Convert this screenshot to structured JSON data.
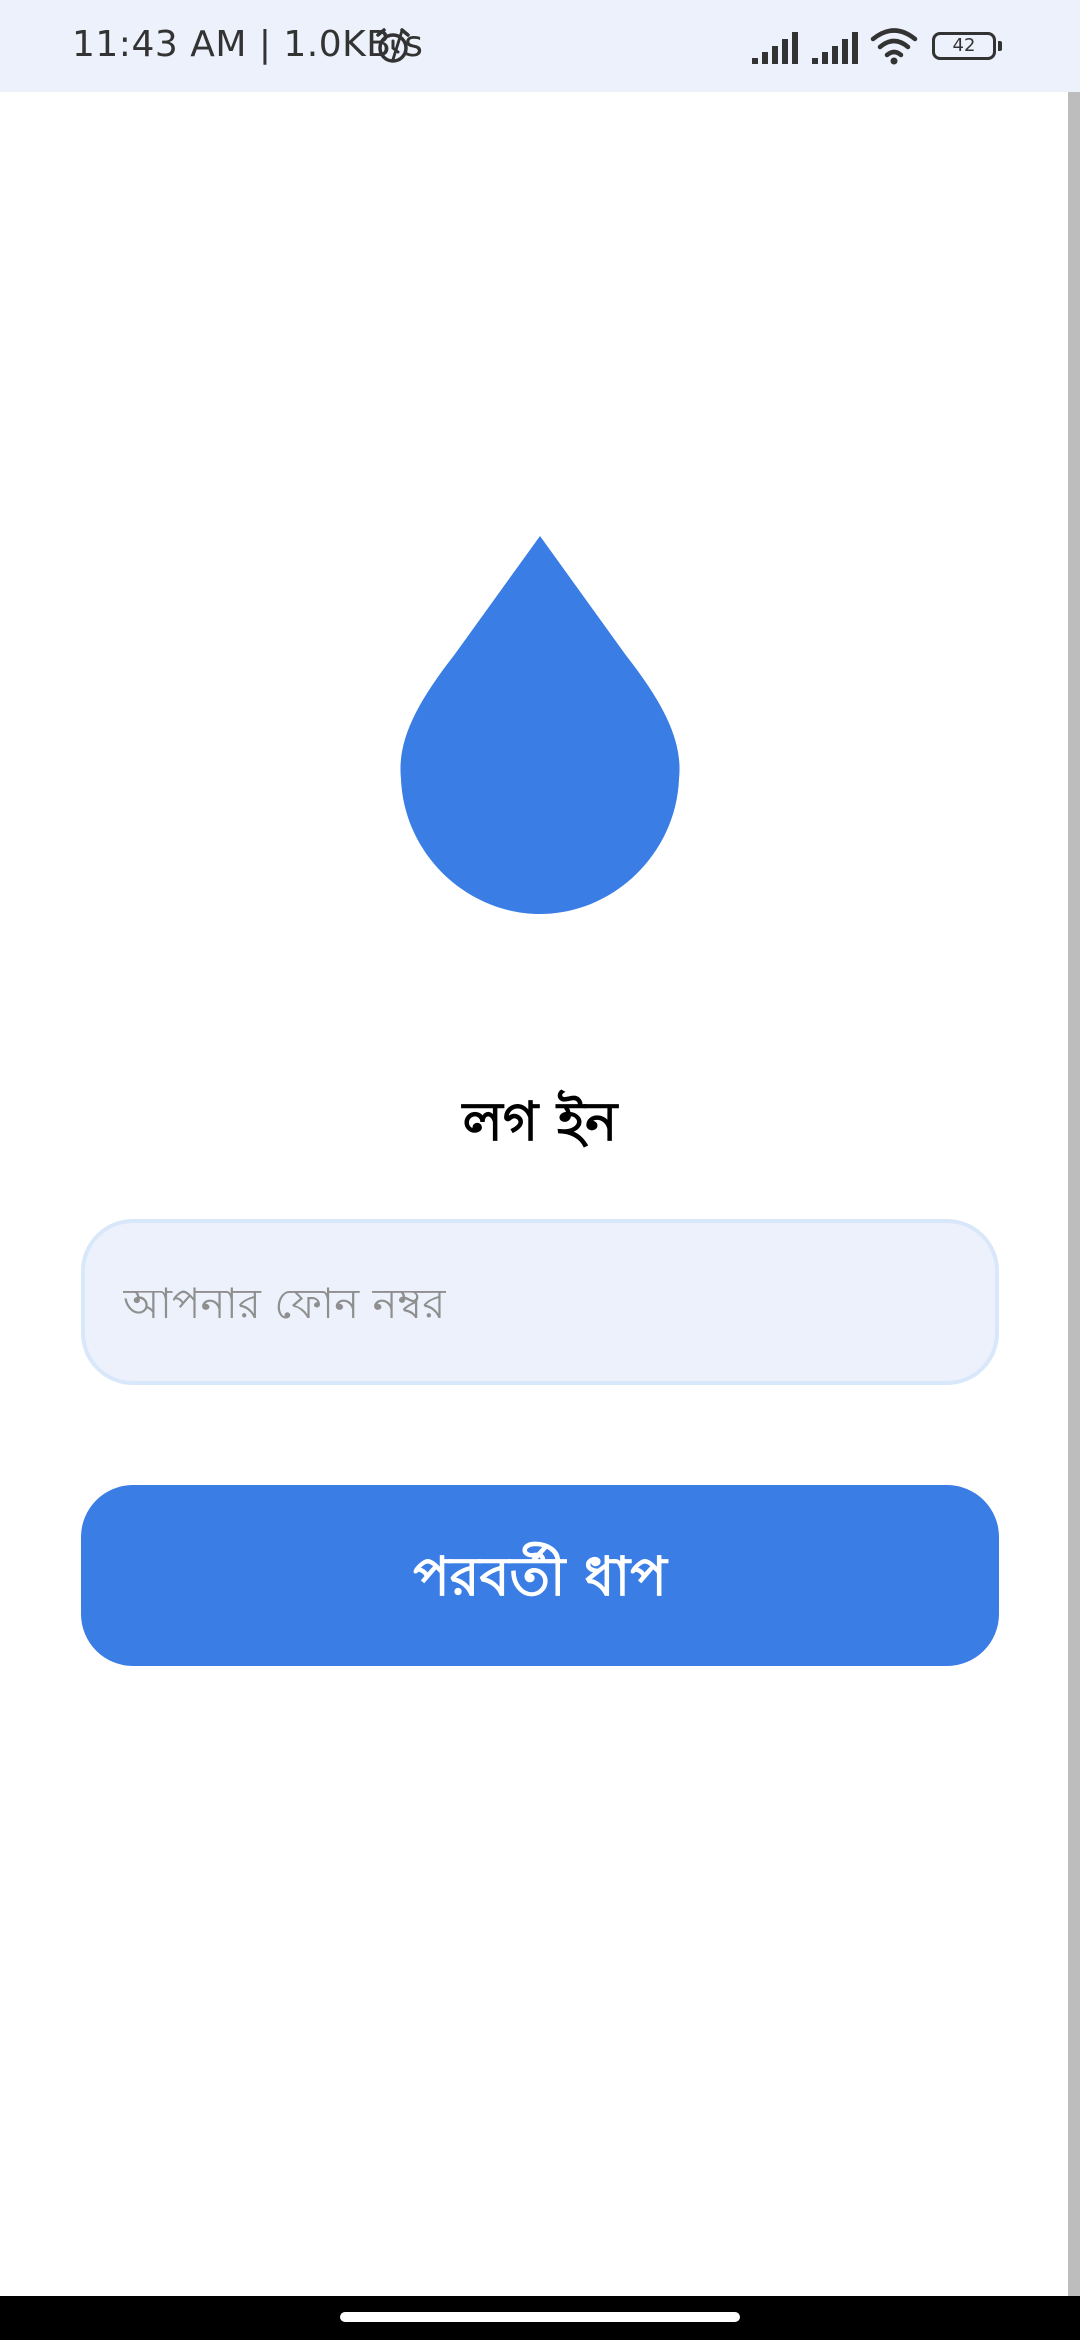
{
  "status_bar": {
    "time_speed": "11:43 AM | 1.0KB/s",
    "battery_level": "42",
    "icons": [
      "alarm-icon",
      "signal-icon",
      "signal-icon",
      "wifi-icon",
      "battery-icon"
    ]
  },
  "logo": {
    "icon": "water-drop-icon",
    "color": "#3a7de5"
  },
  "login": {
    "title": "লগ ইন",
    "phone_placeholder": "আপনার ফোন নম্বর",
    "phone_value": "",
    "next_label": "পরবর্তী ধাপ"
  },
  "colors": {
    "accent": "#3a7de5",
    "input_bg": "#ecf1fb",
    "status_bar_bg": "#ecf1fb"
  }
}
